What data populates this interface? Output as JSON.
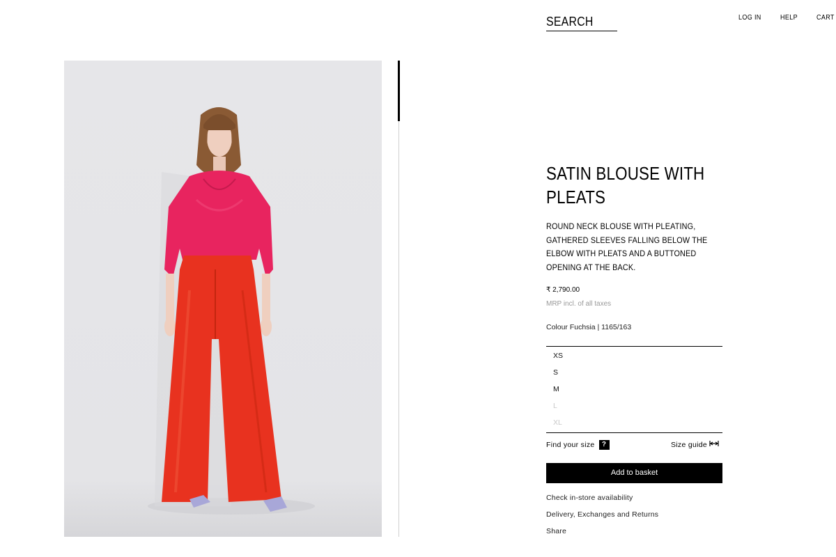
{
  "header": {
    "search_label": "SEARCH",
    "nav": {
      "login": "LOG IN",
      "help": "HELP",
      "cart": "CART"
    }
  },
  "product": {
    "title": "SATIN BLOUSE WITH PLEATS",
    "description": "ROUND NECK BLOUSE WITH PLEATING, GATHERED SLEEVES FALLING BELOW THE ELBOW WITH PLEATS AND A BUTTONED OPENING AT THE BACK.",
    "price": "₹ 2,790.00",
    "price_note": "MRP incl. of all taxes",
    "colour_line": "Colour Fuchsia | 1165/163",
    "blouse_color": "#e8245f",
    "trousers_color": "#e8321f",
    "sizes": [
      {
        "label": "XS",
        "available": true
      },
      {
        "label": "S",
        "available": true
      },
      {
        "label": "M",
        "available": true
      },
      {
        "label": "L",
        "available": false
      },
      {
        "label": "XL",
        "available": false
      }
    ],
    "find_size_label": "Find your size",
    "find_size_icon": "?",
    "size_guide_label": "Size guide",
    "size_guide_icon": "ruler-icon",
    "add_to_basket": "Add to basket",
    "links": {
      "store": "Check in-store availability",
      "delivery": "Delivery, Exchanges and Returns",
      "share": "Share"
    }
  },
  "gallery": {
    "image": "product-photo"
  }
}
